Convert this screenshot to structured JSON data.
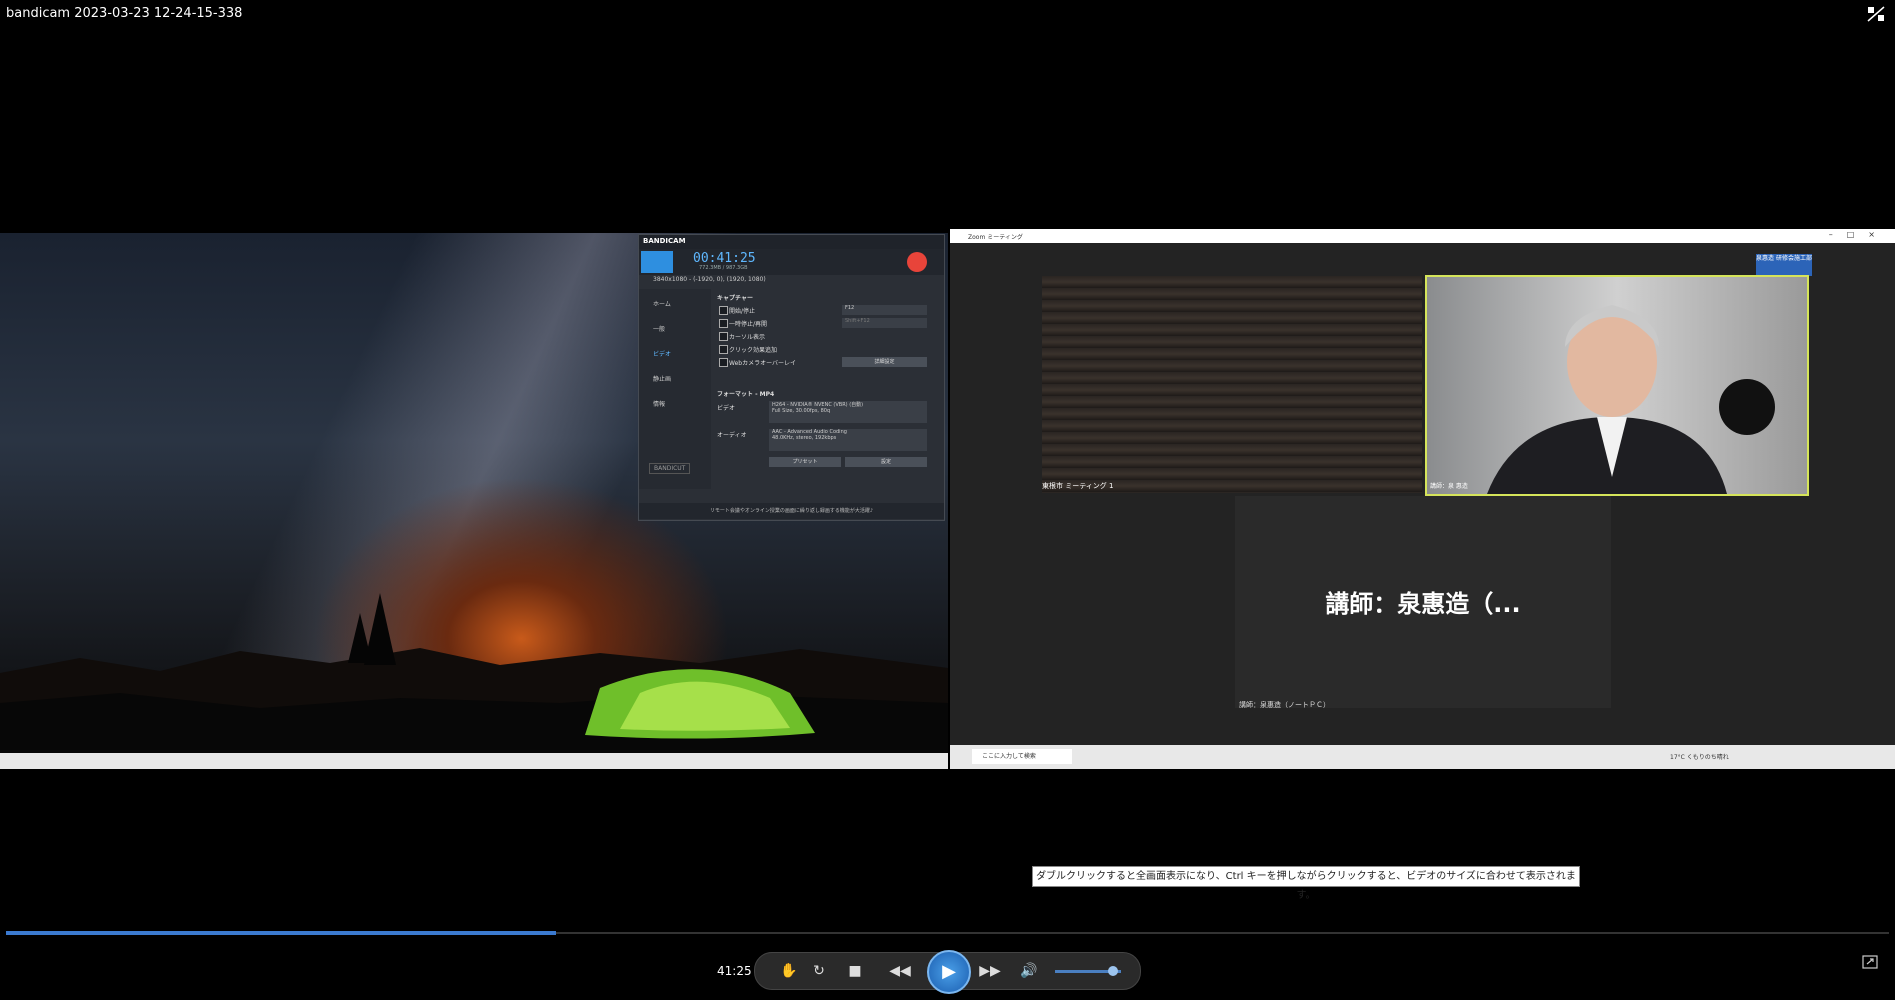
{
  "window": {
    "title": "bandicam 2023-03-23 12-24-15-338"
  },
  "bandicam": {
    "brand": "BANDICAM",
    "timer": "00:41:25",
    "size": "772.3MB / 987.3GB",
    "mode": "3840x1080 - (-1920, 0), (1920, 1080)",
    "sidebar": [
      "ホーム",
      "一般",
      "ビデオ",
      "静止画",
      "情報"
    ],
    "section_capture": "キャプチャー",
    "options": [
      "開始/停止",
      "一時停止/再開",
      "カーソル表示",
      "クリック効果追加",
      "Webカメラオーバーレイ"
    ],
    "hotkey1": "F12",
    "hotkey2": "Shift+F12",
    "detail_button": "詳細設定",
    "section_format": "フォーマット - MP4",
    "video_label": "ビデオ",
    "video_value_1": "H264 - NVIDIA® NVENC (VBR) (自動)",
    "video_value_2": "Full Size, 30.00fps, 80q",
    "audio_label": "オーディオ",
    "audio_value_1": "AAC - Advanced Audio Coding",
    "audio_value_2": "48.0KHz, stereo, 192kbps",
    "preset_button": "プリセット",
    "settings_button": "設定",
    "bandicut": "BANDICUT",
    "footer": "リモート会議やオンライン授業の画面に繰り返し録画する機能が大活躍♪"
  },
  "zoom": {
    "window_title": "Zoom ミーティング",
    "audience_label": "東根市 ミーティング 1",
    "speaker_label": "講師：泉 惠造",
    "namecard": "泉惠造 研修会施工部",
    "big_name": "講師：泉惠造（...",
    "name_tile_label": "講師：泉惠造（ノートＰＣ）",
    "search_placeholder": "ここに入力して検索",
    "weather": "17°C くもりのち晴れ"
  },
  "tooltip": "ダブルクリックすると全画面表示になり、Ctrl キーを押しながらクリックすると、ビデオのサイズに合わせて表示されます。",
  "player": {
    "time": "41:25",
    "progress_fraction": 0.292,
    "volume_fraction": 0.88
  },
  "icons": [
    "fullscreen-icon",
    "hand-icon",
    "repeat-icon",
    "stop-icon",
    "rewind-icon",
    "play-icon",
    "forward-icon",
    "volume-icon",
    "resize-icon"
  ]
}
